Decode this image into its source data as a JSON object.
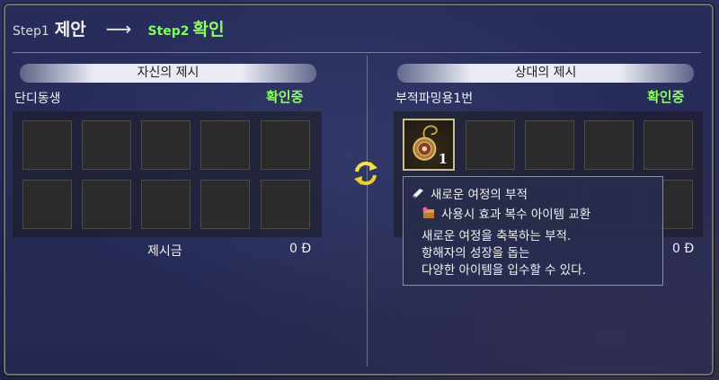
{
  "steps": {
    "step1_label": "Step1",
    "step1_name": "제안",
    "arrow": "⟶",
    "step2_label": "Step2",
    "step2_name": "확인"
  },
  "left": {
    "title": "자신의 제시",
    "owner": "단디동생",
    "status": "확인중",
    "money_label": "제시금",
    "money_value": "0 Đ"
  },
  "right": {
    "title": "상대의 제시",
    "owner": "부적파밍용1번",
    "status": "확인중",
    "money_value": "0 Đ",
    "item_quantity": "1"
  },
  "tooltip": {
    "item_name": "새로운 여정의 부적",
    "use_effect": "사용시 효과  복수 아이템 교환",
    "desc_lines": [
      "새로운 여정을 축복하는 부적.",
      "항해자의 성장을 돕는",
      "다양한 아이템을 입수할 수 있다."
    ]
  },
  "colors": {
    "status_green": "#8cff62",
    "title_bar": "#e9ecf4"
  },
  "icons": [
    "swap-icon",
    "amulet-item-icon",
    "scroll-icon",
    "chest-icon"
  ]
}
